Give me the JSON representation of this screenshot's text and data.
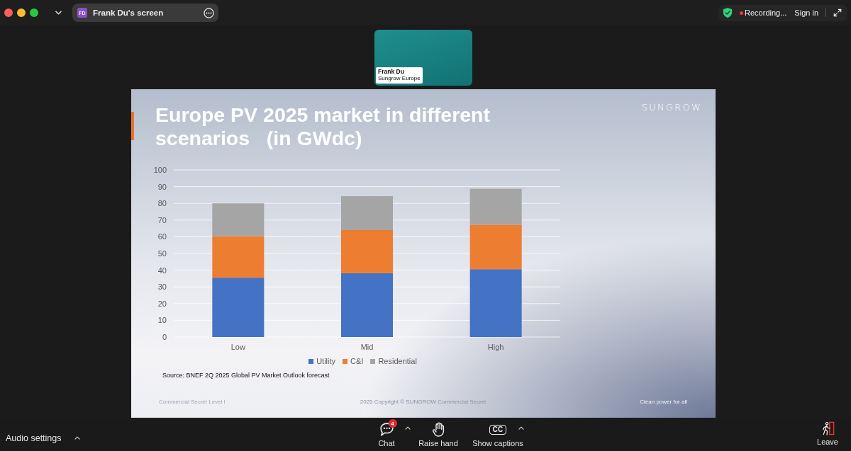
{
  "title_bar": {
    "share_tab": {
      "initials": "FD",
      "label": "Frank Du's screen"
    },
    "status": {
      "recording": "Recording...",
      "sign_in": "Sign in"
    }
  },
  "video_tile": {
    "name": "Frank Du",
    "subtitle": "Sungrow Europe"
  },
  "slide": {
    "title": "Europe PV 2025 market in different scenarios   (in GWdc)",
    "logo": "SUNGROW",
    "chart_data": {
      "type": "bar",
      "stacked": true,
      "grid": true,
      "legend": "bottom",
      "categories": [
        "Low",
        "Mid",
        "High"
      ],
      "series": [
        {
          "name": "Utility",
          "color": "#4472c4",
          "values": [
            35.5,
            38.2,
            40.6
          ]
        },
        {
          "name": "C&I",
          "color": "#ed7d31",
          "values": [
            24.8,
            25.8,
            26.6
          ]
        },
        {
          "name": "Residential",
          "color": "#a5a5a5",
          "values": [
            19.7,
            20.3,
            21.5
          ]
        }
      ],
      "ylim": [
        0,
        100
      ],
      "yticks": [
        0,
        10,
        20,
        30,
        40,
        50,
        60,
        70,
        80,
        90,
        100
      ]
    },
    "source": "Source: BNEF 2Q 2025 Global PV Market Outlook forecast",
    "footer": [
      "Commercial Secret Level I",
      "2025 Copyright © SUNGROW Commercial Secret",
      "Clean power for all"
    ]
  },
  "toolbar": {
    "audio_settings": "Audio settings",
    "buttons": [
      {
        "kind": "chat",
        "label": "Chat",
        "badge": "4",
        "menu": true
      },
      {
        "kind": "hand",
        "label": "Raise hand",
        "menu": false
      },
      {
        "kind": "captions",
        "label": "Show captions",
        "glyph": "CC",
        "menu": true
      }
    ],
    "leave": "Leave"
  }
}
